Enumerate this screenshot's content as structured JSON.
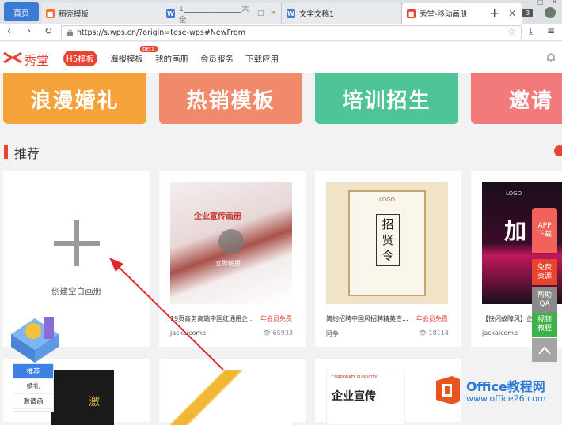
{
  "browser": {
    "home_tab": "首页",
    "tabs": [
      {
        "title": "稻壳模板",
        "favicon": "orange"
      },
      {
        "title": "1▁▁▁▁▁▁▁▁▁▁大全",
        "favicon": "blue"
      },
      {
        "title": "文字文稿1",
        "favicon": "blue"
      },
      {
        "title": "秀堂-移动画册",
        "favicon": "red",
        "active": true
      }
    ],
    "new_tab": "+",
    "tab_count": "3",
    "url": "https://s.wps.cn/?origin=tese-wps#NewFrom"
  },
  "site": {
    "logo_text": "秀堂",
    "nav": {
      "h5": "H5模板",
      "poster": "海报模板",
      "beta": "beta",
      "my_album": "我的画册",
      "member": "会员服务",
      "download": "下载应用"
    }
  },
  "banners": [
    {
      "text": "浪漫婚礼",
      "color": "#f6a23a"
    },
    {
      "text": "热销模板",
      "color": "#f08a6a"
    },
    {
      "text": "培训招生",
      "color": "#4fc497"
    },
    {
      "text": "邀请",
      "color": "#f27a7a"
    }
  ],
  "section": {
    "title": "推荐"
  },
  "blank_card": {
    "label": "创建空白画册"
  },
  "cards": [
    {
      "title": "19页商务高端中国红通用企...",
      "vip": "年会员免费",
      "author": "jackalcome",
      "views": "65933",
      "poster_text": "企业宣传画册",
      "hover_label": "立即使用"
    },
    {
      "title": "简约招聘中国风招聘精美古...",
      "vip": "年会员免费",
      "author": "阿争",
      "views": "18114",
      "poster_text": "招贤令",
      "poster_logo": "LOGO"
    },
    {
      "title": "【快闪故障风】企业...",
      "author": "jackalcome",
      "poster_text": "加",
      "poster_logo": "LOGO"
    }
  ],
  "row2": [
    {
      "poster_text": "激"
    },
    {
      "poster_text": ""
    },
    {
      "poster_text": "企业宣传",
      "poster_sub": "CORPORATE PUBLICITY"
    }
  ],
  "side_buttons": [
    {
      "text": "APP\n下载",
      "color": "#f0625a"
    },
    {
      "text": "免费\n资源",
      "color": "#e8432f"
    },
    {
      "text": "帮助\nQA",
      "color": "#8a8a8a"
    },
    {
      "text": "视频\n教程",
      "color": "#3db24a"
    },
    {
      "text": "",
      "color": "#9a9a9a"
    }
  ],
  "left_menu": {
    "items": [
      "推荐",
      "婚礼",
      "邀请函"
    ]
  },
  "watermark": {
    "brand": "Office教程网",
    "url": "www.office26.com"
  }
}
